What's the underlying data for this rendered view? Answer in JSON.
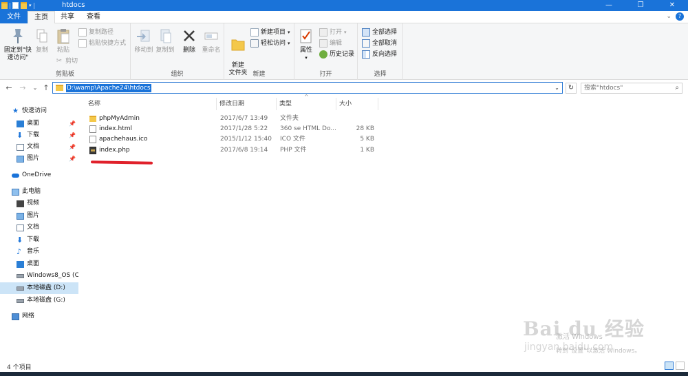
{
  "window": {
    "title": "htdocs",
    "controls": {
      "minimize": "—",
      "maximize": "❐",
      "close": "✕"
    }
  },
  "ribbon_tabs": [
    "文件",
    "主页",
    "共享",
    "查看"
  ],
  "ribbon": {
    "clipboard": {
      "label": "剪贴板",
      "pin_quick": "固定到\"快速访问\"",
      "copy": "复制",
      "paste": "粘贴",
      "copy_path": "复制路径",
      "paste_shortcut": "粘贴快捷方式",
      "cut": "剪切"
    },
    "organize": {
      "label": "组织",
      "move_to": "移动到",
      "copy_to": "复制到",
      "delete": "删除",
      "rename": "重命名"
    },
    "new": {
      "label": "新建",
      "new_folder": "新建\n文件夹",
      "new_item": "新建项目",
      "easy_access": "轻松访问"
    },
    "open": {
      "label": "打开",
      "properties": "属性",
      "open": "打开",
      "edit": "编辑",
      "history": "历史记录"
    },
    "select": {
      "label": "选择",
      "select_all": "全部选择",
      "select_none": "全部取消",
      "invert": "反向选择"
    }
  },
  "address": {
    "path": "D:\\wamp\\Apache24\\htdocs",
    "search_placeholder": "搜索\"htdocs\""
  },
  "nav": {
    "quick_access": "快速访问",
    "quick_items": [
      "桌面",
      "下载",
      "文档",
      "图片"
    ],
    "onedrive": "OneDrive",
    "this_pc": "此电脑",
    "pc_items": [
      "视频",
      "图片",
      "文档",
      "下载",
      "音乐",
      "桌面",
      "Windows8_OS (C:)",
      "本地磁盘 (D:)",
      "本地磁盘 (G:)"
    ],
    "network": "网络"
  },
  "columns": {
    "name": "名称",
    "date": "修改日期",
    "type": "类型",
    "size": "大小"
  },
  "files": [
    {
      "name": "phpMyAdmin",
      "date": "2017/6/7 13:49",
      "type": "文件夹",
      "size": "",
      "icon": "folder-icon"
    },
    {
      "name": "index.html",
      "date": "2017/1/28 5:22",
      "type": "360 se HTML Do...",
      "size": "28 KB",
      "icon": "html-file-icon"
    },
    {
      "name": "apachehaus.ico",
      "date": "2015/1/12 15:40",
      "type": "ICO 文件",
      "size": "5 KB",
      "icon": "ico-file-icon"
    },
    {
      "name": "index.php",
      "date": "2017/6/8 19:14",
      "type": "PHP 文件",
      "size": "1 KB",
      "icon": "php-file-icon"
    }
  ],
  "status": {
    "count": "4 个项目"
  },
  "watermark": {
    "brand": "Bai du 经验",
    "url": "jingyan.baidu.com",
    "activate": "激活 Windows",
    "activate_hint": "转到\"设置\"以激活 Windows。"
  },
  "colors": {
    "accent": "#1a73d9",
    "selection": "#cce4f7",
    "annotation": "#e0212b"
  }
}
